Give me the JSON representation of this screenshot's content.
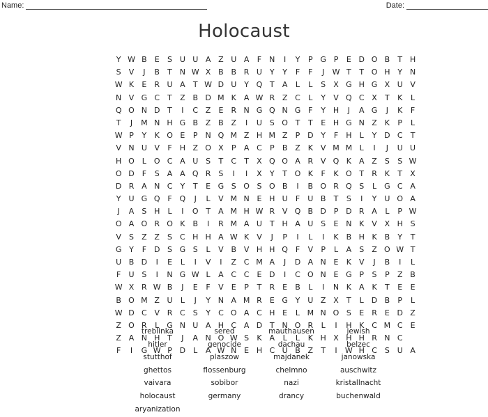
{
  "header": {
    "name_label": "Name:",
    "date_label": "Date:"
  },
  "title": "Holocaust",
  "grid": [
    "YWBESUUAZUAFNIYPGPEDOBTH",
    "SVJBTNWXBBRUYYFFJWTTOHYN",
    "WKERUATWDUYQTALLSXGHGXUV",
    "NVGCTZBDMKAWRZCLYVQCXTKL",
    "QONDTICZERNGQNGFYHJAGJKF",
    "TJMNHGBZBZIUSOTTEHGNZKPL",
    "WPYKOEPNQMZHMZPDYFHLYDCT",
    "VNUVFHZOXPACPBZKVMMLIJUU",
    "HOLOCAUSTCTXQOARVQKAZSSW",
    "ODFSAAQRSIIXYTOKFKOTRKTX",
    "DRANCYTEGSOSOBIBORQSLGCA",
    "YUGQFQJLVMNEHUFUBTSIYUOA",
    "JASHLIOTAMHWRVQBDPDRALPW",
    "OAOROKBIRMAUTHAUSENKVXHS",
    "VSZZSCHHAWKVJPILIKBHKBYT",
    "GYFDSGSLVBVHHQFVPLASZOWT",
    "UBDIELIVIZCMAJDANEKVJBIL",
    "FUSINGWLACCEDICONEGPSPZB",
    "WXRWBJEFVEPTREBLINKAKTEE",
    "BOMZULJYNAMREGYUZXTLDBPL",
    "WDCVRCSYCOACHELMNOSEREDZ",
    "ZORLGNUAHCADTNORLIHKCMCE",
    "ZANHTJANOWSKALLKHXHHRNC",
    "FIGWPDLAWNEHCUBZTIWHCSUA"
  ],
  "word_list": [
    "treblinka",
    "sered",
    "mauthausen",
    "jewish",
    "hitler",
    "genocide",
    "dachau",
    "belzec",
    "stutthof",
    "plaszow",
    "majdanek",
    "janowska",
    "ghettos",
    "flossenburg",
    "chelmno",
    "auschwitz",
    "vaivara",
    "sobibor",
    "nazi",
    "kristallnacht",
    "holocaust",
    "germany",
    "drancy",
    "buchenwald",
    "aryanization"
  ]
}
